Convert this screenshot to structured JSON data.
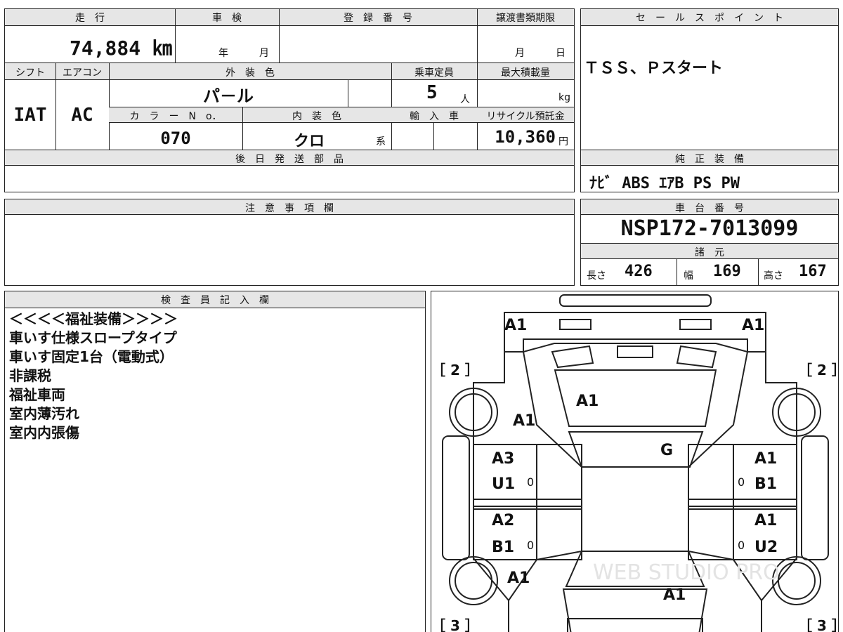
{
  "top_table": {
    "headers": {
      "mileage": "走　行",
      "inspection": "車　検",
      "registration": "登　録　番　号",
      "transfer_deadline": "譲渡書類期限",
      "shift": "シフト",
      "aircon": "エアコン",
      "exterior_color": "外　装　色",
      "capacity": "乗車定員",
      "max_load": "最大積載量",
      "color_no": "カ　ラ　ー　N　o．",
      "interior_color": "内　装　色",
      "imported": "輸　入　車",
      "recycle": "リサイクル預託金",
      "later_parts": "後　日　発　送　部　品"
    },
    "values": {
      "mileage": "74,884 ㎞",
      "inspection_year": "年",
      "inspection_month": "月",
      "transfer_month": "月",
      "transfer_day": "日",
      "shift": "IAT",
      "aircon": "AC",
      "exterior_color": "パ－ル",
      "capacity": "5",
      "capacity_unit": "人",
      "max_load_unit": "kg",
      "color_no": "070",
      "interior_color": "クロ",
      "interior_suffix": "系",
      "recycle": "10,360",
      "recycle_unit": "円"
    }
  },
  "sales_point": {
    "title": "セ　ー　ル　ス　ポ　イ　ン　ト",
    "text": "ＴＳＳ、Ｐスタート"
  },
  "standard_equipment": {
    "title": "純　正　装　備",
    "text": "ﾅﾋﾞ ABS ｴｱB PS PW"
  },
  "notes": {
    "title": "注　意　事　項　欄"
  },
  "chassis": {
    "title": "車　台　番　号",
    "number": "NSP172-7013099",
    "spec_title": "諸　元",
    "length_label": "長さ",
    "length": "426",
    "width_label": "幅",
    "width": "169",
    "height_label": "高さ",
    "height": "167"
  },
  "inspector": {
    "title": "検　査　員　記　入　欄",
    "lines": [
      "＜＜＜＜福祉装備＞＞＞＞",
      "車いす仕様スロープタイプ",
      "車いす固定1台（電動式）",
      "非課税",
      "福祉車両",
      "室内薄汚れ",
      "室内内張傷"
    ]
  },
  "diagram": {
    "labels": {
      "front_left": "A1",
      "front_right": "A1",
      "hood": "A1",
      "front_fender_left": "A1",
      "windshield": "G",
      "left_front_door_1": "A3",
      "left_front_door_2": "U1",
      "right_front_door_1": "A1",
      "right_front_door_2": "B1",
      "left_rear_door_1": "A2",
      "left_rear_door_2": "B1",
      "right_rear_door_1": "A1",
      "right_rear_door_2": "U2",
      "rear_fender_left": "A1",
      "rear": "A1",
      "tire_fl": "［ 2 ］",
      "tire_fr": "［ 2 ］",
      "tire_rl": "［ 3 ］",
      "tire_rr": "［ 3 ］",
      "handle_lf": "0",
      "handle_rf": "0",
      "handle_lr": "0",
      "handle_rr": "0"
    },
    "watermark": "WEB STUDIO PRO"
  }
}
